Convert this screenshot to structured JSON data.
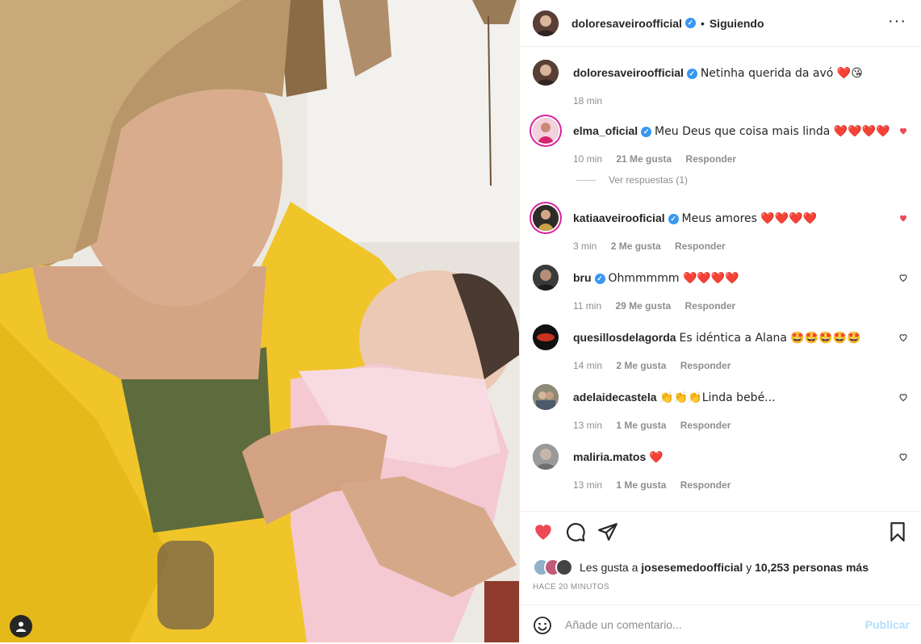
{
  "post": {
    "author": "doloresaveiroofficial",
    "follow_status": "Siguiendo",
    "caption_author": "doloresaveiroofficial",
    "caption_text": "Netinha querida da avó ❤️😘",
    "caption_time": "18 min"
  },
  "comments": [
    {
      "user": "elma_oficial",
      "text": "Meu Deus que coisa mais linda ❤️❤️❤️❤️",
      "time": "10 min",
      "likes": "21 Me gusta",
      "reply": "Responder",
      "view_replies": "Ver respuestas (1)",
      "liked": true
    },
    {
      "user": "katiaaveirooficial",
      "text": "Meus amores ❤️❤️❤️❤️",
      "time": "3 min",
      "likes": "2 Me gusta",
      "reply": "Responder",
      "liked": true
    },
    {
      "user": "bru",
      "text": "Ohmmmmm ❤️❤️❤️❤️",
      "time": "11 min",
      "likes": "29 Me gusta",
      "reply": "Responder",
      "liked": false
    },
    {
      "user": "quesillosdelagorda",
      "text": "Es idéntica a Alana 🤩🤩🤩🤩🤩",
      "time": "14 min",
      "likes": "2 Me gusta",
      "reply": "Responder",
      "liked": false
    },
    {
      "user": "adelaidecastela",
      "text": "👏👏👏Linda bebé...",
      "time": "13 min",
      "likes": "1 Me gusta",
      "reply": "Responder",
      "liked": false
    },
    {
      "user": "maliria.matos",
      "text": "❤️",
      "time": "13 min",
      "likes": "1 Me gusta",
      "reply": "Responder",
      "liked": false
    }
  ],
  "likes": {
    "prefix": "Les gusta a",
    "user": "josesemedoofficial",
    "joiner": "y",
    "others": "10,253 personas más"
  },
  "time_ago": "HACE 20 MINUTOS",
  "add_comment": {
    "placeholder": "Añade un comentario...",
    "publish": "Publicar"
  },
  "colors": {
    "heart_red": "#ed4956",
    "verified_blue": "#3897f0",
    "publish_disabled": "#b2dffc"
  },
  "icons": [
    "user-tag-icon",
    "verified-icon",
    "more-options-icon",
    "heart-icon",
    "comment-icon",
    "share-icon",
    "bookmark-icon",
    "emoji-icon"
  ]
}
